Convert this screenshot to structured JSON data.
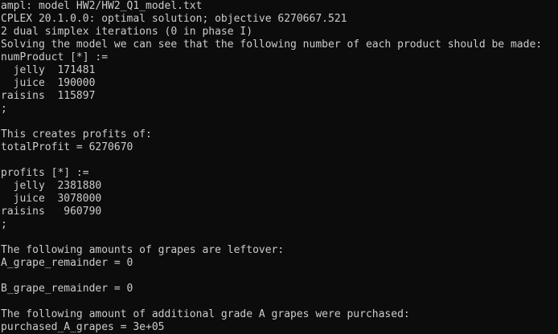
{
  "terminal": {
    "foreground": "#cccccc",
    "background": "#0c0c0c",
    "lines": [
      "ampl: model HW2/HW2_Q1_model.txt",
      "CPLEX 20.1.0.0: optimal solution; objective 6270667.521",
      "2 dual simplex iterations (0 in phase I)",
      "Solving the model we can see that the following number of each product should be made:",
      "numProduct [*] :=",
      "  jelly  171481",
      "  juice  190000",
      "raisins  115897",
      ";",
      "",
      "This creates profits of:",
      "totalProfit = 6270670",
      "",
      "profits [*] :=",
      "  jelly  2381880",
      "  juice  3078000",
      "raisins   960790",
      ";",
      "",
      "The following amounts of grapes are leftover:",
      "A_grape_remainder = 0",
      "",
      "B_grape_remainder = 0",
      "",
      "The following amount of additional grade A grapes were purchased:",
      "purchased_A_grapes = 3e+05"
    ]
  }
}
